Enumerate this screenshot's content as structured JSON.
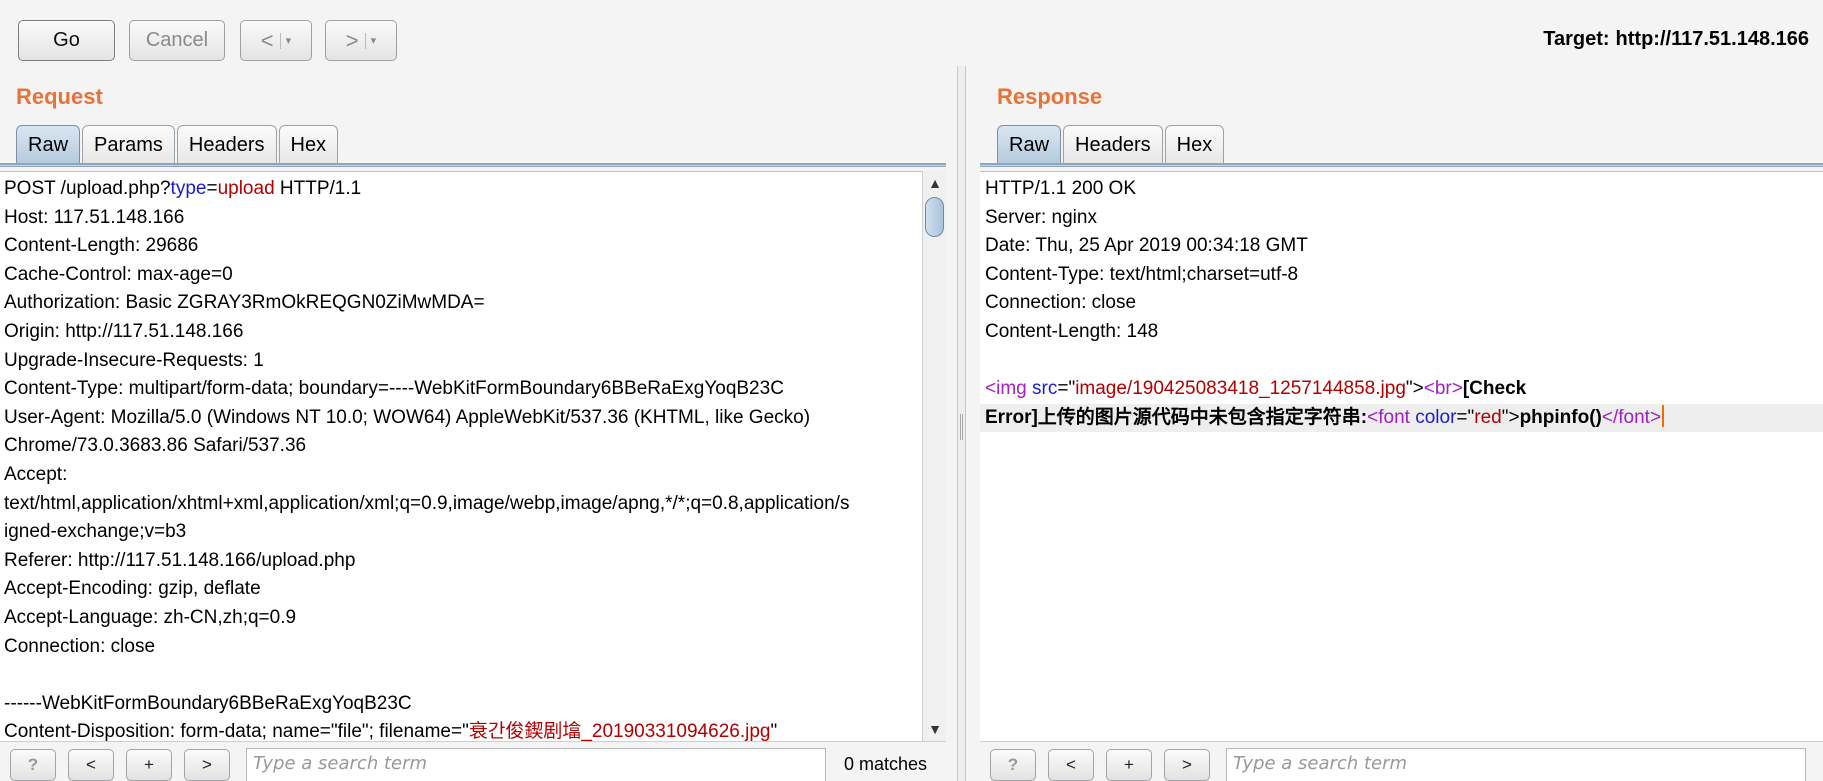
{
  "toolbar": {
    "go_label": "Go",
    "cancel_label": "Cancel",
    "back_label": "<",
    "forward_label": ">",
    "dropdown_glyph": "▾",
    "target_label": "Target:",
    "target_url": "http://117.51.148.166"
  },
  "request": {
    "title": "Request",
    "tabs": [
      "Raw",
      "Params",
      "Headers",
      "Hex"
    ],
    "active_tab": "Raw",
    "lines": {
      "l1_a": "POST /upload.php?",
      "l1_key": "type",
      "l1_eq": "=",
      "l1_val": "upload",
      "l1_b": " HTTP/1.1",
      "l2": "Host: 117.51.148.166",
      "l3": "Content-Length: 29686",
      "l4": "Cache-Control: max-age=0",
      "l5": "Authorization: Basic ZGRAY3RmOkREQGN0ZiMwMDA=",
      "l6": "Origin: http://117.51.148.166",
      "l7": "Upgrade-Insecure-Requests: 1",
      "l8": "Content-Type: multipart/form-data; boundary=----WebKitFormBoundary6BBeRaExgYoqB23C",
      "l9": "User-Agent: Mozilla/5.0 (Windows NT 10.0; WOW64) AppleWebKit/537.36 (KHTML, like Gecko)",
      "l10": "Chrome/73.0.3683.86 Safari/537.36",
      "l11": "Accept:",
      "l12": "text/html,application/xhtml+xml,application/xml;q=0.9,image/webp,image/apng,*/*;q=0.8,application/s",
      "l13": "igned-exchange;v=b3",
      "l14": "Referer: http://117.51.148.166/upload.php",
      "l15": "Accept-Encoding: gzip, deflate",
      "l16": "Accept-Language: zh-CN,zh;q=0.9",
      "l17": "Connection: close",
      "l19": "------WebKitFormBoundary6BBeRaExgYoqB23C",
      "l20_a": "Content-Disposition: form-data; name=\"file\"; filename=\"",
      "l20_val": "衰간俊鍥剧墖_20190331094626.jpg",
      "l20_b": "\""
    },
    "search": {
      "help_label": "?",
      "prev_label": "<",
      "add_label": "+",
      "next_label": ">",
      "placeholder": "Type a search term",
      "matches": "0 matches"
    }
  },
  "response": {
    "title": "Response",
    "tabs": [
      "Raw",
      "Headers",
      "Hex"
    ],
    "active_tab": "Raw",
    "lines": {
      "l1": "HTTP/1.1 200 OK",
      "l2": "Server: nginx",
      "l3": "Date: Thu, 25 Apr 2019 00:34:18 GMT",
      "l4": "Content-Type: text/html;charset=utf-8",
      "l5": "Connection: close",
      "l6": "Content-Length: 148",
      "b1_lt": "<",
      "b1_tag": "img",
      "b1_attr": "src",
      "b1_eq": "=\"",
      "b1_val": "image/190425083418_1257144858.jpg",
      "b1_q": "\">",
      "b1_lt2": "<",
      "b1_tag2": "br",
      "b1_gt2": ">",
      "b1_bold": "[Check",
      "b2_bold": "Error]上传的图片源代码中未包含指定字符串:",
      "b2_lt": "<",
      "b2_tag": "font",
      "b2_attr": "color",
      "b2_eq": "=\"",
      "b2_val": "red",
      "b2_q": "\">",
      "b2_bold2": "phpinfo()",
      "b2_close_lt": "</",
      "b2_close_tag": "font",
      "b2_close_gt": ">"
    },
    "search": {
      "help_label": "?",
      "prev_label": "<",
      "add_label": "+",
      "next_label": ">",
      "placeholder": "Type a search term"
    }
  }
}
